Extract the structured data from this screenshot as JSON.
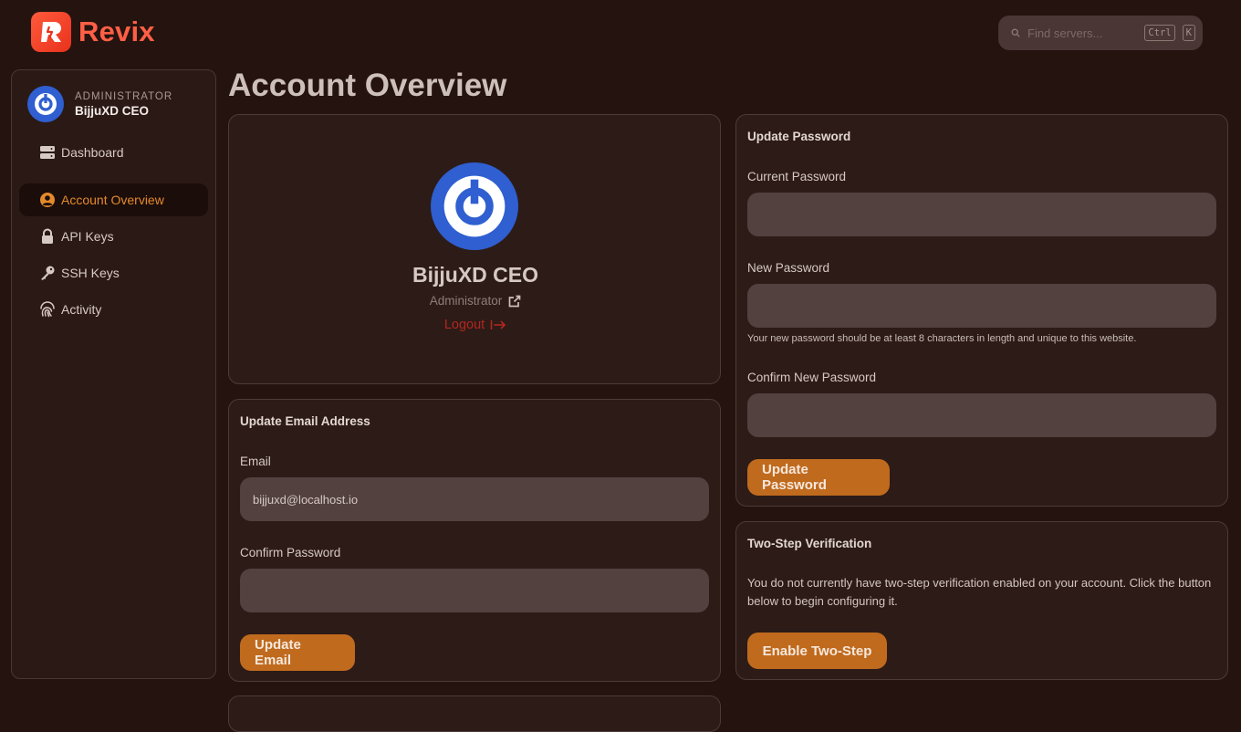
{
  "brand": {
    "name": "Revix"
  },
  "search": {
    "placeholder": "Find servers...",
    "kbd_ctrl": "Ctrl",
    "kbd_key": "K"
  },
  "sidebar": {
    "role": "ADMINISTRATOR",
    "user_name": "BijjuXD CEO",
    "items": [
      {
        "label": "Dashboard",
        "icon": "server-icon",
        "active": false
      },
      {
        "label": "Account Overview",
        "icon": "user-circle-icon",
        "active": true
      },
      {
        "label": "API Keys",
        "icon": "lock-icon",
        "active": false
      },
      {
        "label": "SSH Keys",
        "icon": "key-icon",
        "active": false
      },
      {
        "label": "Activity",
        "icon": "fingerprint-icon",
        "active": false
      }
    ]
  },
  "page": {
    "title": "Account Overview"
  },
  "profile": {
    "name": "BijjuXD CEO",
    "role": "Administrator",
    "logout": "Logout"
  },
  "email_card": {
    "title": "Update Email Address",
    "email_label": "Email",
    "email_value": "bijjuxd@localhost.io",
    "confirm_label": "Confirm Password",
    "confirm_value": "",
    "button": "Update Email"
  },
  "password_card": {
    "title": "Update Password",
    "current_label": "Current Password",
    "new_label": "New Password",
    "hint": "Your new password should be at least 8 characters in length and unique to this website.",
    "confirm_label": "Confirm New Password",
    "button": "Update Password"
  },
  "twostep_card": {
    "title": "Two-Step Verification",
    "text": "You do not currently have two-step verification enabled on your account. Click the button below to begin configuring it.",
    "button": "Enable Two-Step"
  },
  "colors": {
    "accent": "#c06a1e",
    "active_nav": "#e58a2b",
    "logout": "#b3261e",
    "brand": "#ff5f45",
    "avatar": "#2f5fd0"
  }
}
